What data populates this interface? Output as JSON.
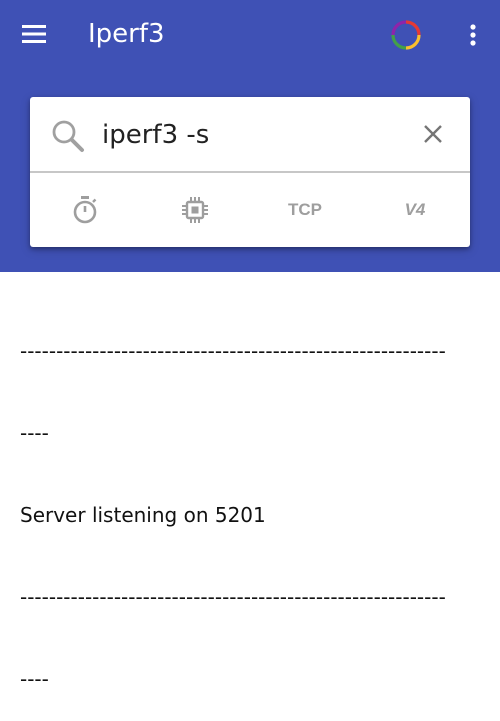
{
  "app": {
    "title": "Iperf3",
    "colors": {
      "primary": "#3f51b5",
      "on_primary": "#ffffff",
      "option_gray": "#9e9e9e"
    },
    "icons": {
      "menu": "menu-icon",
      "sync": "sync-progress-icon",
      "overflow": "more-vert-icon"
    }
  },
  "search": {
    "value": "iperf3 -s",
    "icons": {
      "search": "search-icon",
      "clear": "close-icon"
    }
  },
  "options": {
    "timer_icon": "timer-icon",
    "cpu_icon": "cpu-icon",
    "protocol": "TCP",
    "ip_version": "V4"
  },
  "output": {
    "lines": [
      "-----------------------------------------------------------",
      "----",
      "Server listening on 5201",
      "-----------------------------------------------------------",
      "----"
    ]
  }
}
